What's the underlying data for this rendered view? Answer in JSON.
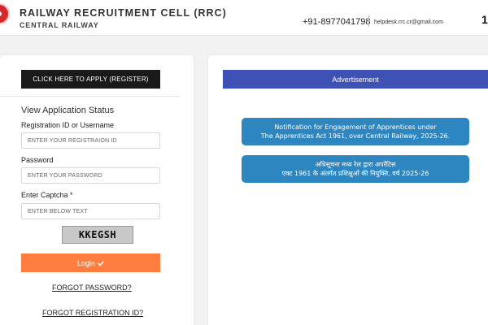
{
  "header": {
    "title": "RAILWAY RECRUITMENT CELL (RRC)",
    "subtitle": "CENTRAL RAILWAY",
    "phone": "+91-8977041798",
    "email": "helpdesk.rrc.cr@gmail.com",
    "corner_text": "1"
  },
  "login": {
    "apply_button": "CLICK HERE TO APPLY (REGISTER)",
    "section_title": "View Application Status",
    "username_label": "Registration ID or Username",
    "username_placeholder": "ENTER YOUR REGISTRAION ID",
    "password_label": "Password",
    "password_placeholder": "ENTER YOUR PASSWORD",
    "captcha_label": "Enter Captcha *",
    "captcha_placeholder": "ENTER BELOW TEXT",
    "captcha_text": "KKEGSH",
    "login_button": "Login",
    "login_icon": "check-icon",
    "forgot_password": "FORGOT PASSWORD?",
    "forgot_registration": "FORGOT REGISTRATION ID?"
  },
  "advertisement": {
    "title": "Advertisement",
    "notices": [
      {
        "line1": "Notification for Engagement of Apprentices under",
        "line2": "The Apprentices Act 1961, over Central Railway, 2025-26."
      },
      {
        "line1": "अधिसूचना मध्य रेल द्वारा अपरेंटिस",
        "line2": "एक्ट 1961 के अंतर्गत प्रशिक्षुओं की नियुक्ति, वर्ष 2025-26"
      }
    ]
  },
  "colors": {
    "apply_button_bg": "#1a1a1a",
    "login_button_bg": "#ff7d3f",
    "advertisement_bar_bg": "#3f51b5",
    "notice_bg": "#2e86c1"
  }
}
